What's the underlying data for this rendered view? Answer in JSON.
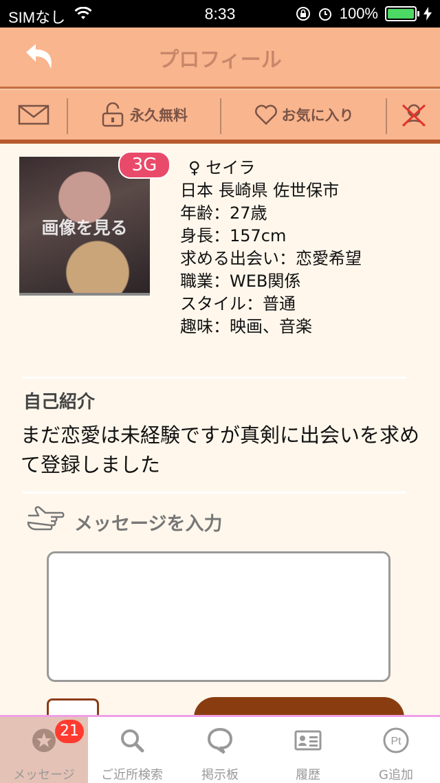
{
  "status": {
    "carrier": "SIMなし",
    "time": "8:33",
    "battery": "100%"
  },
  "nav": {
    "title": "プロフィール"
  },
  "actions": {
    "free_label": "永久無料",
    "favorite_label": "お気に入り"
  },
  "profile": {
    "photo_label": "画像を見る",
    "network_badge": "3G",
    "name": "♀ セイラ",
    "location": "日本 長崎県 佐世保市",
    "age": "年齢：27歳",
    "height": "身長：157cm",
    "seeking": "求める出会い：恋愛希望",
    "job": "職業：WEB関係",
    "style": "スタイル：普通",
    "hobby": "趣味：映画、音楽"
  },
  "intro": {
    "heading": "自己紹介",
    "text": " まだ恋愛は未経験ですが真剣に出会いを求めて登録しました"
  },
  "message": {
    "heading": "メッセージを入力",
    "value": ""
  },
  "tabs": [
    {
      "label": "メッセージ",
      "badge": "21",
      "active": true
    },
    {
      "label": "ご近所検索"
    },
    {
      "label": "掲示板"
    },
    {
      "label": "履歴"
    },
    {
      "label": "G追加"
    }
  ],
  "colors": {
    "header": "#f9b58d",
    "accent": "#b65a2d",
    "background": "#fff7ec",
    "badge": "#ff3b30"
  }
}
